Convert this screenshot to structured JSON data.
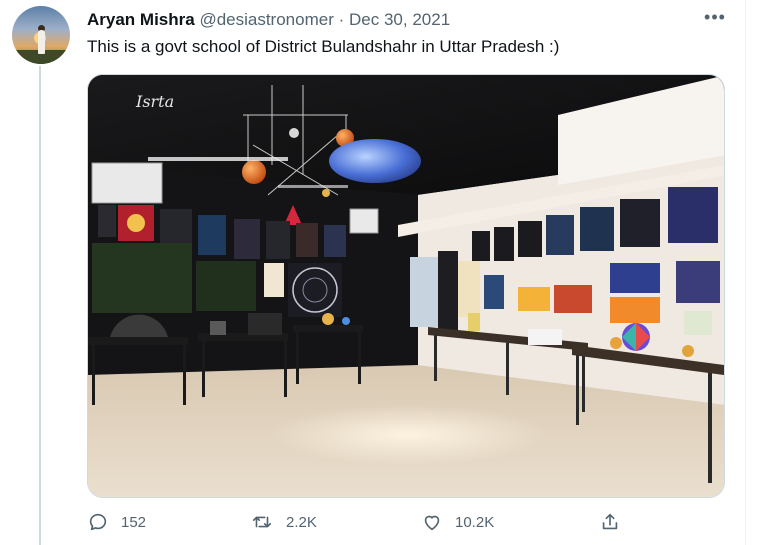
{
  "user": {
    "name": "Aryan Mishra",
    "handle": "@desiastronomer",
    "separator": "·",
    "date": "Dec 30, 2021"
  },
  "tweet": {
    "text": "This is a govt school of District Bulandshahr in Uttar Pradesh :)"
  },
  "media": {
    "description_icon": "photo-astronomy-lab",
    "wall_sign": "Isrta"
  },
  "actions": {
    "reply_count": "152",
    "retweet_count": "2.2K",
    "like_count": "10.2K"
  },
  "colors": {
    "text_primary": "#0f1419",
    "text_secondary": "#536471",
    "border": "#cfd9de"
  }
}
